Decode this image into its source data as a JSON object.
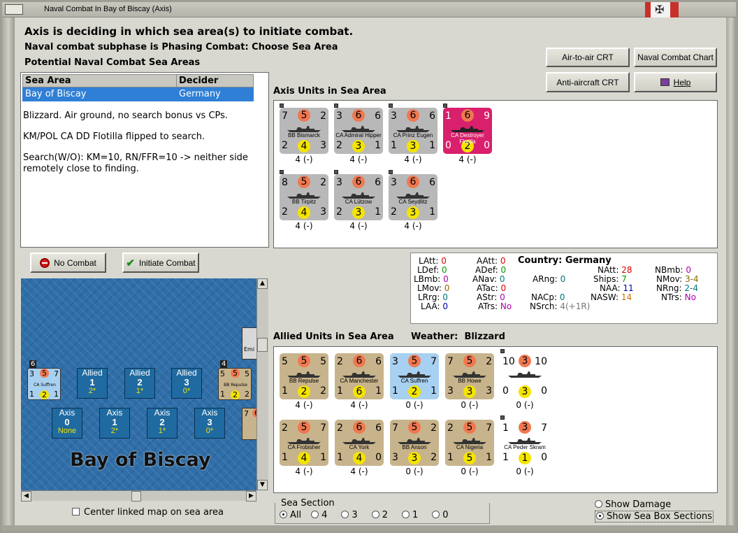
{
  "window": {
    "title": "Naval Combat In Bay of Biscay (Axis)"
  },
  "header": {
    "line1": "Axis is deciding in which sea area(s) to initiate combat.",
    "line2": "Naval combat subphase is Phasing Combat: Choose Sea Area",
    "line3": "Potential Naval Combat Sea Areas"
  },
  "buttons": {
    "air_crt": "Air-to-air CRT",
    "naval_chart": "Naval Combat Chart",
    "aa_crt": "Anti-aircraft CRT",
    "help": "Help",
    "no_combat": "No Combat",
    "initiate": "Initiate Combat"
  },
  "sea_table": {
    "headers": [
      "Sea Area",
      "Decider"
    ],
    "row": [
      "Bay of Biscay",
      "Germany"
    ]
  },
  "info": [
    "Blizzard.  Air ground, no search bonus vs CPs.",
    "KM/POL CA DD Flotilla flipped to search.",
    "Search(W/O):  KM=10, RN/FFR=10 -> neither side remotely close to finding."
  ],
  "axis_label": "Axis Units in Sea Area",
  "axis_units": [
    {
      "name": "BB Bismarck",
      "tl": "7",
      "tc": "5",
      "tr": "2",
      "bl": "2",
      "bc": "4",
      "br": "3",
      "sub": "4 (-)",
      "style": "grey"
    },
    {
      "name": "CA Admiral Hipper",
      "tl": "3",
      "tc": "6",
      "tr": "6",
      "bl": "2",
      "bc": "3",
      "br": "1",
      "sub": "4 (-)",
      "style": "grey"
    },
    {
      "name": "CA Prinz Eugen",
      "tl": "3",
      "tc": "6",
      "tr": "6",
      "bl": "1",
      "bc": "3",
      "br": "1",
      "sub": "4 (-)",
      "style": "grey"
    },
    {
      "name": "CA Destroyer Flotilla",
      "tl": "1",
      "tc": "6",
      "tr": "9",
      "bl": "0",
      "bc": "2",
      "br": "0",
      "sub": "4 (-)",
      "style": "pink"
    },
    {
      "name": "BB Tirpitz",
      "tl": "8",
      "tc": "5",
      "tr": "2",
      "bl": "2",
      "bc": "4",
      "br": "3",
      "sub": "4 (-)",
      "style": "grey"
    },
    {
      "name": "CA Lützow",
      "tl": "3",
      "tc": "6",
      "tr": "6",
      "bl": "2",
      "bc": "3",
      "br": "1",
      "sub": "4 (-)",
      "style": "grey"
    },
    {
      "name": "CA Seydlitz",
      "tl": "3",
      "tc": "6",
      "tr": "6",
      "bl": "2",
      "bc": "3",
      "br": "1",
      "sub": "4 (-)",
      "style": "grey"
    }
  ],
  "stats": {
    "LAtt": "0",
    "LDef": "0",
    "LBmb": "0",
    "LMov": "0",
    "LRrg": "0",
    "LAA": "0",
    "AAtt": "0",
    "ADef": "0",
    "ANav": "0",
    "ATac": "0",
    "AStr": "0",
    "ATrs": "No",
    "ARng": "0",
    "country_label": "Country:",
    "country": "Germany",
    "NAtt": "28",
    "Ships": "7",
    "NAA": "11",
    "NASW": "14",
    "NACp": "0",
    "NSrch": "4(+1R)",
    "NBmb": "0",
    "NMov": "3-4",
    "NRng": "2-4",
    "NTrs": "No"
  },
  "allied_label": "Allied Units in Sea Area",
  "weather_label": "Weather:",
  "weather": "Blizzard",
  "allied_units": [
    {
      "name": "BB Repulse",
      "tl": "5",
      "tc": "5",
      "tr": "5",
      "bl": "1",
      "bc": "2",
      "br": "2",
      "sub": "4 (-)",
      "style": "tan"
    },
    {
      "name": "CA Manchester",
      "tl": "2",
      "tc": "6",
      "tr": "6",
      "bl": "1",
      "bc": "6",
      "br": "1",
      "sub": "4 (-)",
      "style": "tan"
    },
    {
      "name": "CA Suffren",
      "tl": "3",
      "tc": "5",
      "tr": "7",
      "bl": "1",
      "bc": "2",
      "br": "1",
      "sub": "0 (-)",
      "style": "blue"
    },
    {
      "name": "BB Howe",
      "tl": "7",
      "tc": "5",
      "tr": "2",
      "bl": "3",
      "bc": "3",
      "br": "3",
      "sub": "0 (-)",
      "style": "tan"
    },
    {
      "name": "",
      "tl": "10",
      "tc": "3",
      "tr": "10",
      "bl": "0",
      "bc": "3",
      "br": "0",
      "sub": "0 (-)",
      "style": "white"
    },
    {
      "name": "CA Frobisher",
      "tl": "2",
      "tc": "5",
      "tr": "7",
      "bl": "1",
      "bc": "4",
      "br": "1",
      "sub": "4 (-)",
      "style": "tan"
    },
    {
      "name": "CA York",
      "tl": "2",
      "tc": "6",
      "tr": "6",
      "bl": "1",
      "bc": "4",
      "br": "0",
      "sub": "4 (-)",
      "style": "tan"
    },
    {
      "name": "BB Anson",
      "tl": "7",
      "tc": "5",
      "tr": "2",
      "bl": "3",
      "bc": "3",
      "br": "2",
      "sub": "0 (-)",
      "style": "tan"
    },
    {
      "name": "CA Nigeria",
      "tl": "2",
      "tc": "5",
      "tr": "7",
      "bl": "1",
      "bc": "5",
      "br": "1",
      "sub": "0 (-)",
      "style": "tan"
    },
    {
      "name": "CA Peder Skram",
      "tl": "1",
      "tc": "3",
      "tr": "7",
      "bl": "1",
      "bc": "1",
      "br": "0",
      "sub": "0 (-)",
      "style": "white"
    }
  ],
  "map": {
    "title": "Bay of Biscay",
    "allied_boxes": [
      {
        "side": "Allied",
        "num": "1",
        "val": "2*"
      },
      {
        "side": "Allied",
        "num": "2",
        "val": "1*"
      },
      {
        "side": "Allied",
        "num": "3",
        "val": "0*"
      }
    ],
    "axis_boxes": [
      {
        "side": "Axis",
        "num": "0",
        "val": "None"
      },
      {
        "side": "Axis",
        "num": "1",
        "val": "2*"
      },
      {
        "side": "Axis",
        "num": "2",
        "val": "1*"
      },
      {
        "side": "Axis",
        "num": "3",
        "val": "0*"
      }
    ],
    "left_counter": {
      "name": "CA Suffren",
      "stack": "6",
      "tl": "3",
      "tc": "5",
      "tr": "7",
      "bl": "1",
      "bc": "2",
      "br": "1"
    },
    "right_counter": {
      "name": "BB Repulse",
      "stack": "4",
      "tl": "5",
      "tc": "5",
      "tr": "5",
      "bl": "1",
      "bc": "2",
      "br": "2"
    },
    "edge_counter_top": {
      "name": "Emi"
    },
    "edge_counter_bottom": {
      "tl": "7",
      "tc": "6"
    }
  },
  "center_map_label": "Center linked map on sea area",
  "sea_section": {
    "label": "Sea Section",
    "options": [
      "All",
      "4",
      "3",
      "2",
      "1",
      "0"
    ],
    "selected": "All"
  },
  "show_damage": "Show Damage",
  "show_sections": "Show Sea Box Sections"
}
